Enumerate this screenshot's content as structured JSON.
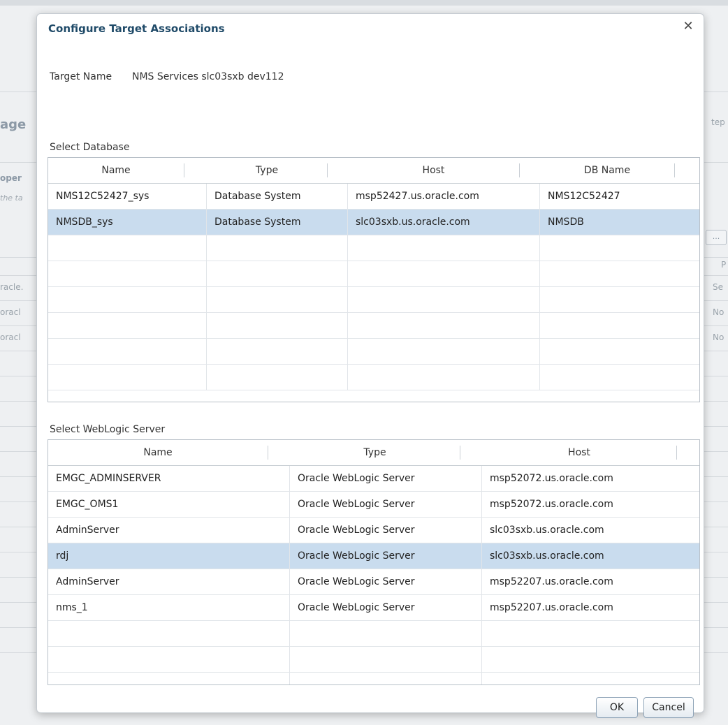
{
  "background": {
    "heading_fragment": "age",
    "sub_fragment": "oper",
    "italic_fragment": "the ta",
    "right_fragment": "tep",
    "button_label": "...",
    "left_rows": [
      "racle.",
      "oracl",
      "oracl"
    ],
    "right_rows": [
      "P",
      "Se",
      "No",
      "No"
    ]
  },
  "dialog": {
    "title": "Configure Target Associations",
    "close_icon": "close-icon",
    "target_name_label": "Target Name",
    "target_name_value": "NMS Services slc03sxb dev112",
    "database_section_label": "Select Database",
    "database_columns": [
      "Name",
      "Type",
      "Host",
      "DB Name"
    ],
    "database_rows": [
      {
        "name": "NMS12C52427_sys",
        "type": "Database System",
        "host": "msp52427.us.oracle.com",
        "db_name": "NMS12C52427",
        "selected": false
      },
      {
        "name": "NMSDB_sys",
        "type": "Database System",
        "host": "slc03sxb.us.oracle.com",
        "db_name": "NMSDB",
        "selected": true
      }
    ],
    "weblogic_section_label": "Select WebLogic Server",
    "weblogic_columns": [
      "Name",
      "Type",
      "Host"
    ],
    "weblogic_rows": [
      {
        "name": "EMGC_ADMINSERVER",
        "type": "Oracle WebLogic Server",
        "host": "msp52072.us.oracle.com",
        "selected": false
      },
      {
        "name": "EMGC_OMS1",
        "type": "Oracle WebLogic Server",
        "host": "msp52072.us.oracle.com",
        "selected": false
      },
      {
        "name": "AdminServer",
        "type": "Oracle WebLogic Server",
        "host": "slc03sxb.us.oracle.com",
        "selected": false
      },
      {
        "name": "rdj",
        "type": "Oracle WebLogic Server",
        "host": "slc03sxb.us.oracle.com",
        "selected": true
      },
      {
        "name": "AdminServer",
        "type": "Oracle WebLogic Server",
        "host": "msp52207.us.oracle.com",
        "selected": false
      },
      {
        "name": "nms_1",
        "type": "Oracle WebLogic Server",
        "host": "msp52207.us.oracle.com",
        "selected": false
      }
    ],
    "ok_label": "OK",
    "cancel_label": "Cancel",
    "colors": {
      "selected_row": "#c9dcee",
      "title": "#1f4a68"
    }
  }
}
